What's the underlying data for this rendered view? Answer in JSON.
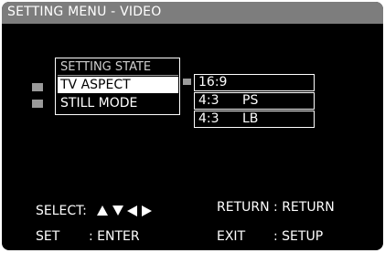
{
  "title": "SETTING MENU - VIDEO",
  "menu": {
    "header": "SETTING STATE",
    "items": [
      "TV ASPECT",
      "STILL MODE"
    ],
    "selected_index": 0
  },
  "options": [
    {
      "ratio": "16:9",
      "mode": ""
    },
    {
      "ratio": "4:3",
      "mode": "PS"
    },
    {
      "ratio": "4:3",
      "mode": "LB"
    }
  ],
  "footer": {
    "select_label": "SELECT:",
    "return_label": "RETURN : RETURN",
    "set_label": "SET",
    "enter_label": ": ENTER",
    "exit_label": "EXIT",
    "setup_label": ": SETUP"
  },
  "colors": {
    "background": "#000000",
    "titlebar": "#7d7d7d",
    "highlight": "#ffffff",
    "text": "#ffffff"
  }
}
